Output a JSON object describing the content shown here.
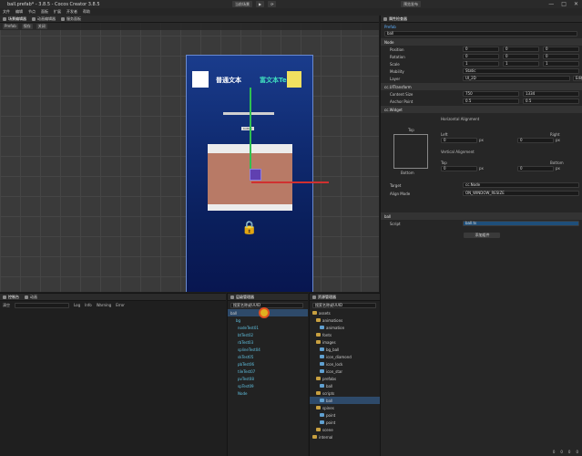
{
  "window": {
    "title": "ball.prefab* - 3.8.5 - Cocos Creator 3.8.5",
    "toolbar_buttons": [
      "当前场景",
      "▶",
      "⟳"
    ],
    "right_label": "预览发布",
    "controls": [
      "—",
      "□",
      "✕"
    ]
  },
  "menu": [
    "文件",
    "编辑",
    "节点",
    "面板",
    "扩展",
    "开发者",
    "帮助"
  ],
  "scene": {
    "tabs": [
      "场景编辑器",
      "动画编辑器",
      "服务面板"
    ],
    "toolbar": [
      "Prefab",
      "保存",
      "关闭"
    ],
    "canvas": {
      "label_normal": "普通文本",
      "label_rich": "富文本Text",
      "button_label": "button"
    }
  },
  "inspector": {
    "tab": "属性检查器",
    "prefab_label": "Prefab",
    "node_name": "ball",
    "node_section": "Node",
    "position": [
      "0",
      "0",
      "0"
    ],
    "rotation": [
      "0",
      "0",
      "0"
    ],
    "scale": [
      "1",
      "1",
      "1"
    ],
    "mobility": "Static",
    "layer": "UI_2D",
    "edit_label": "Edit",
    "uitransform_section": "cc.UITransform",
    "content_size": [
      "750",
      "1334"
    ],
    "anchor_point": [
      "0.5",
      "0.5"
    ],
    "widget_section": "cc.Widget",
    "horizontal_alignment": "Horizontal Alignment",
    "left_label": "Left",
    "left_value": "0",
    "right_label": "Right",
    "right_value": "0",
    "vertical_alignment": "Vertical Alignment",
    "top_label": "Top",
    "top_value": "0",
    "bottom_label": "Bottom",
    "bottom_value": "0",
    "unit": "px",
    "target_label": "Target",
    "target_value": "cc.Node",
    "align_mode_label": "Align Mode",
    "align_mode_value": "ON_WINDOW_RESIZE",
    "ball_section": "ball",
    "script_label": "Script",
    "script_value": "ball.ts",
    "add_component": "添加组件",
    "props": {
      "position": "Position",
      "rotation": "Rotation",
      "scale": "Scale",
      "mobility": "Mobility",
      "layer": "Layer",
      "content_size": "Content Size",
      "anchor_point": "Anchor Point"
    }
  },
  "console": {
    "tabs": [
      "控制台",
      "动画"
    ],
    "clear": "清空",
    "filters": [
      "Log",
      "Info",
      "Warning",
      "Error"
    ]
  },
  "hierarchy": {
    "tab": "层级管理器",
    "search_placeholder": "搜索名称或UUID",
    "items": [
      "ball",
      "bg",
      "nodeTest01",
      "btTest02",
      "rbTest03",
      "splineTest04",
      "skTest05",
      "pbTest06",
      "tileTest07",
      "pvTest08",
      "spTest09",
      "Node"
    ]
  },
  "assets": {
    "tab": "资源管理器",
    "search_placeholder": "搜索名称或UUID",
    "items": [
      "assets",
      "animations",
      "animation",
      "fonts",
      "images",
      "bg_ball",
      "icon_diamond",
      "icon_lock",
      "icon_star",
      "prefabs",
      "ball",
      "scripts",
      "ball",
      "spines",
      "point",
      "point",
      "scene",
      "internal"
    ]
  },
  "status": [
    "0",
    "0",
    "0",
    "0"
  ]
}
